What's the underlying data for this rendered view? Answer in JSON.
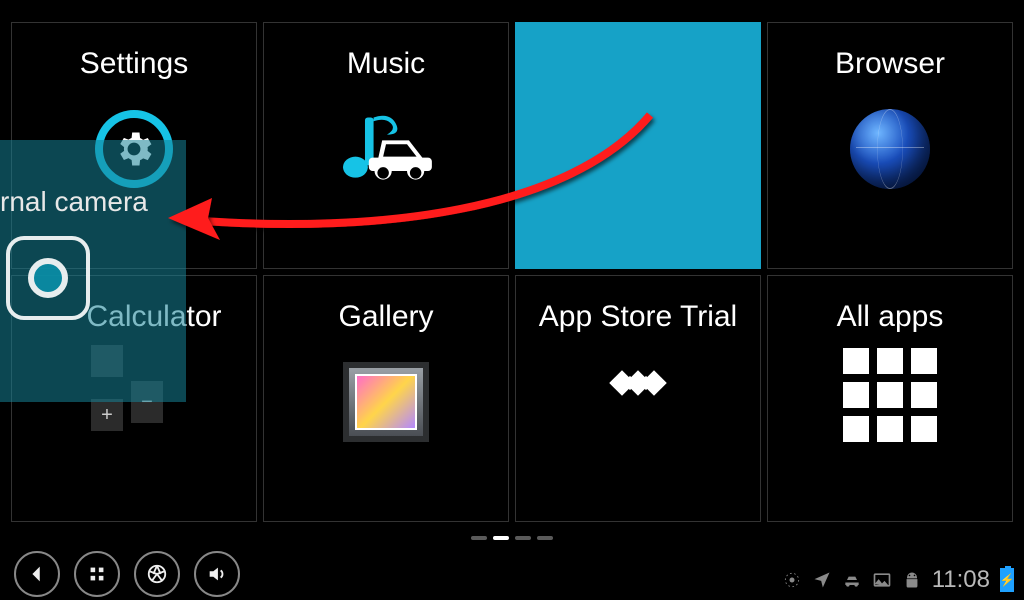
{
  "tiles": [
    {
      "label": "Settings"
    },
    {
      "label": "Music"
    },
    {
      "label": ""
    },
    {
      "label": "Browser"
    },
    {
      "label": "Calculator"
    },
    {
      "label": "Gallery"
    },
    {
      "label": "App Store Trial"
    },
    {
      "label": "All apps"
    }
  ],
  "drag": {
    "label": "rnal camera"
  },
  "pager": {
    "count": 4,
    "active": 1
  },
  "status": {
    "time": "11:08"
  }
}
